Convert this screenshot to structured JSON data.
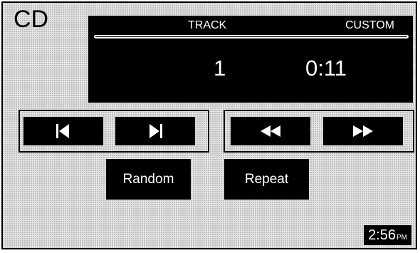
{
  "screen": {
    "source_title": "CD"
  },
  "info_panel": {
    "track_heading": "TRACK",
    "custom_heading": "CUSTOM",
    "track_number": "1",
    "elapsed_time": "0:11"
  },
  "transport": {
    "previous_icon": "skip-previous-icon",
    "next_icon": "skip-next-icon",
    "rewind_icon": "rewind-icon",
    "fast_forward_icon": "fast-forward-icon"
  },
  "modes": {
    "random_label": "Random",
    "repeat_label": "Repeat"
  },
  "clock": {
    "time": "2:56",
    "ampm": "PM"
  },
  "colors": {
    "panel": "#000000",
    "text_on_panel": "#ffffff",
    "background": "#e6e6e6"
  }
}
